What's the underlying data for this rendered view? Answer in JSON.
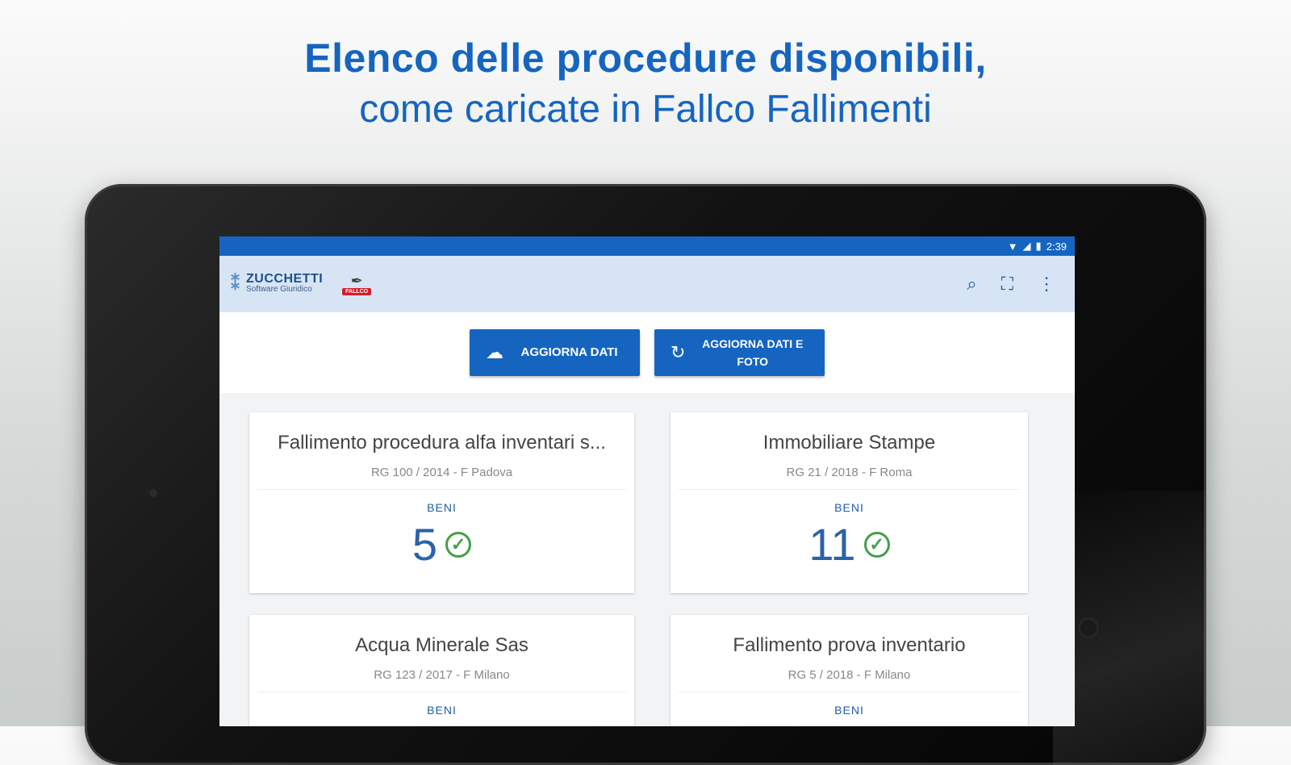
{
  "headline": {
    "line1": "Elenco delle procedure disponibili,",
    "line2": "come caricate in Fallco Fallimenti"
  },
  "statusbar": {
    "time": "2:39",
    "wifi_icon": "wifi-icon",
    "signal_icon": "signal-icon",
    "battery_icon": "battery-icon"
  },
  "appbar": {
    "brand_name": "ZUCCHETTI",
    "brand_sub": "Software Giuridico",
    "partner_tag": "FALLCO",
    "icons": [
      "search-icon",
      "scan-icon",
      "more-vert-icon"
    ]
  },
  "toolbar": {
    "update_label": "AGGIORNA DATI",
    "update_photos_line1": "AGGIORNA DATI E",
    "update_photos_line2": "FOTO"
  },
  "procedures": [
    {
      "title": "Fallimento procedura alfa inventari s...",
      "subtitle": "RG 100 / 2014 - F Padova",
      "beni_label": "BENI",
      "count": "5",
      "status": "completed"
    },
    {
      "title": "Immobiliare Stampe",
      "subtitle": "RG 21 / 2018 - F Roma",
      "beni_label": "BENI",
      "count": "11",
      "status": "completed"
    },
    {
      "title": "Acqua Minerale Sas",
      "subtitle": "RG 123 / 2017 - F Milano",
      "beni_label": "BENI",
      "count": "",
      "status": ""
    },
    {
      "title": "Fallimento prova inventario",
      "subtitle": "RG 5 / 2018 - F Milano",
      "beni_label": "BENI",
      "count": "",
      "status": ""
    }
  ],
  "colors": {
    "primary": "#1565c0",
    "appbar": "#d6e4f4",
    "check": "#43a047"
  }
}
